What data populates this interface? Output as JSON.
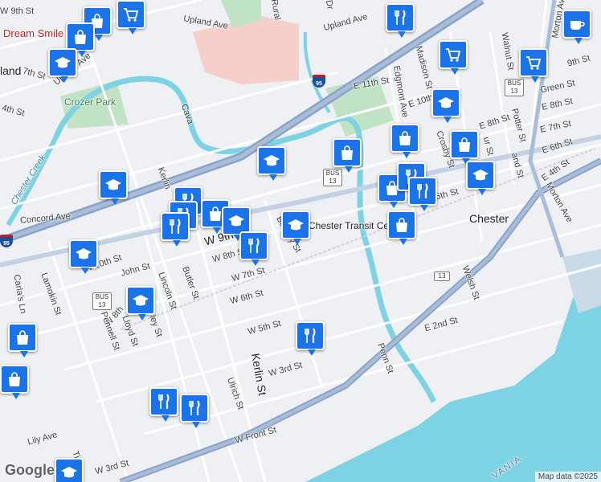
{
  "map": {
    "attribution": "Map data ©2025",
    "logo": "Google",
    "colors": {
      "land": "#eef0f3",
      "water": "#7dd3e3",
      "park": "#bfe3c4",
      "highway": "#8aa4c8",
      "major": "#ffffff",
      "hospital": "#f6c9c6"
    }
  },
  "labels": {
    "upland_ave_w": "Upland Ave",
    "upland_ave_e": "Upland Ave",
    "rural": "Rural",
    "dr": "Dr",
    "w9th_top": "W 9th St",
    "seventh_st": "7th St",
    "upland_ave_rot": "Upland Ave",
    "fourth_st": "4th St",
    "crozer_park": "Crozer Park",
    "chester_creek": "Chester Creek",
    "concord_ave": "Concord Ave",
    "kerlin_top": "Kerlin",
    "cava": "Cava",
    "madison_st": "Madison St",
    "edgmont_ave": "Edgmont Ave",
    "e11th": "E 11th St",
    "e10th": "E 10th",
    "green_st": "Green St",
    "e8th_r": "E 8th St",
    "e8th_mid": "E 8th St",
    "e7th": "E 7th St",
    "e6th": "E 6th St",
    "crosby_st": "Crosby St",
    "walnut_st": "Walnut St",
    "potter_st": "Potter St",
    "morton_ave": "Morton Ave",
    "morton_ave2": "Morton Ave",
    "e9th": "9th St",
    "e5th": "5th St",
    "e4th": "E 4th St",
    "chester": "Chester",
    "chester_transit": "Chester Transit Ce",
    "barclay_st": "Barclay St",
    "w9th_main": "W 9th",
    "w8th": "W 8th St",
    "w7th": "W 7th St",
    "w6th": "W 6th St",
    "w5th": "W 5th St",
    "w3rd": "W 3rd St",
    "w10th": "W 10th St",
    "john_st": "John St",
    "butler_st": "Butler St",
    "lincoln_st": "Lincoln St",
    "lamokin_st": "Lamokin St",
    "w8th_left": "W 8th",
    "lloyd_st": "Lloyd St",
    "pennell_st": "Pennell St",
    "ley_st": "ley St",
    "carlas_ln": "Carla's Ln",
    "kerlin_st": "Kerlin St",
    "ulrich_st": "Ulrich St",
    "penn_st": "Penn St",
    "e2nd": "E 2nd St",
    "welsh_st": "Welsh St",
    "w_front": "W Front St",
    "lily_ave": "Lily Ave",
    "w3rd_bottom": "W 3rd St",
    "ti": "Ti",
    "vania": "VANIA",
    "dream_smile": "Dream Smile",
    "land": "land",
    "and_st": "and St",
    "ur_st": "ur St"
  },
  "shields": {
    "i95": "95",
    "i95_left": "95",
    "bus13_a": "BUS 13",
    "bus13_b": "BUS 13",
    "bus13_c": "BUS 13",
    "r13_a": "13",
    "r13_b": "13"
  },
  "pins": [
    {
      "icon": "shopping-bag-icon"
    },
    {
      "icon": "shopping-cart-icon"
    },
    {
      "icon": "shopping-bag-icon"
    },
    {
      "icon": "school-icon"
    },
    {
      "icon": "restaurant-icon"
    },
    {
      "icon": "cafe-icon"
    },
    {
      "icon": "shopping-cart-icon"
    },
    {
      "icon": "shopping-cart-icon"
    },
    {
      "icon": "school-icon"
    },
    {
      "icon": "school-icon"
    },
    {
      "icon": "shopping-bag-icon"
    },
    {
      "icon": "shopping-bag-icon"
    },
    {
      "icon": "shopping-bag-icon"
    },
    {
      "icon": "school-icon"
    },
    {
      "icon": "shopping-bag-icon"
    },
    {
      "icon": "restaurant-icon"
    },
    {
      "icon": "restaurant-icon"
    },
    {
      "icon": "school-icon"
    },
    {
      "icon": "restaurant-icon"
    },
    {
      "icon": "restaurant-icon"
    },
    {
      "icon": "shopping-bag-icon"
    },
    {
      "icon": "restaurant-icon"
    },
    {
      "icon": "school-icon"
    },
    {
      "icon": "school-icon"
    },
    {
      "icon": "shopping-bag-icon"
    },
    {
      "icon": "restaurant-icon"
    },
    {
      "icon": "school-icon"
    },
    {
      "icon": "school-icon"
    },
    {
      "icon": "shopping-bag-icon"
    },
    {
      "icon": "restaurant-icon"
    },
    {
      "icon": "shopping-bag-icon"
    },
    {
      "icon": "restaurant-icon"
    },
    {
      "icon": "restaurant-icon"
    },
    {
      "icon": "school-icon"
    }
  ]
}
